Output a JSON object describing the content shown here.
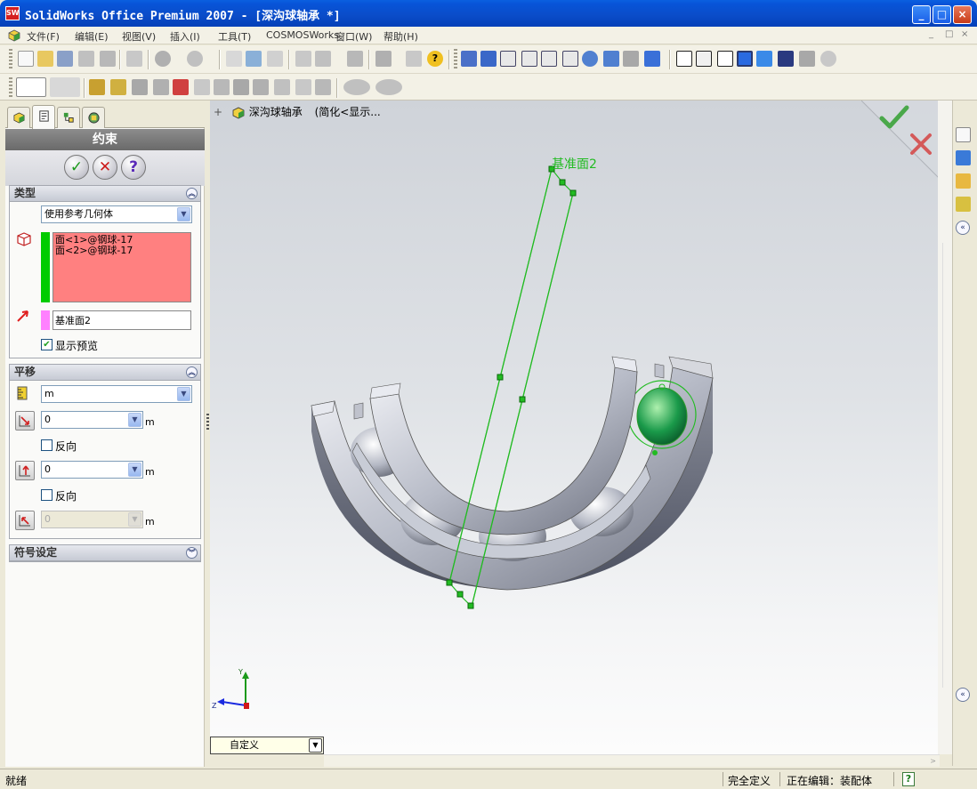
{
  "window": {
    "title": "SolidWorks Office Premium 2007 - [深沟球轴承 *]",
    "app_icon_text": "SW",
    "minimize": "_",
    "maximize": "□",
    "close": "×"
  },
  "menu": {
    "items": [
      "文件(F)",
      "编辑(E)",
      "视图(V)",
      "插入(I)",
      "工具(T)",
      "COSMOSWorks",
      "窗口(W)",
      "帮助(H)"
    ],
    "doc_controls": [
      "_",
      "□",
      "×"
    ]
  },
  "panel": {
    "tabs": [
      "feature-manager",
      "property-manager",
      "configuration-manager",
      "display-manager"
    ],
    "header_title": "约束",
    "ok_symbol": "✓",
    "cancel_symbol": "✕",
    "help_symbol": "?",
    "type_group": {
      "title": "类型",
      "mode_value": "使用参考几何体",
      "selections": [
        "面<1>@钢球-17",
        "面<2>@钢球-17"
      ],
      "reference_value": "基准面2",
      "show_preview_label": "显示预览",
      "show_preview_checked": true
    },
    "translate_group": {
      "title": "平移",
      "unit_value": "m",
      "offset1_value": "0",
      "offset1_unit": "m",
      "reverse1_label": "反向",
      "offset2_value": "0",
      "offset2_unit": "m",
      "reverse2_label": "反向",
      "offset3_value": "0",
      "offset3_unit": "m"
    },
    "symbol_group": {
      "title": "符号设定"
    }
  },
  "graphics": {
    "tree_root": "深沟球轴承",
    "tree_suffix": "(简化<显示...",
    "plane_label": "基准面2",
    "triad": {
      "y": "Y",
      "z": "Z"
    },
    "view_combo_value": "自定义"
  },
  "colors": {
    "selection_box": "#ff8080",
    "selection_strip": "#00cc00",
    "reference_strip": "#ff80ff",
    "plane_line": "#22bb22",
    "bearing_steel": "#9aa0ae"
  },
  "status": {
    "left": "就绪",
    "constraint": "完全定义",
    "editing": "正在编辑：装配体",
    "help": "?"
  }
}
